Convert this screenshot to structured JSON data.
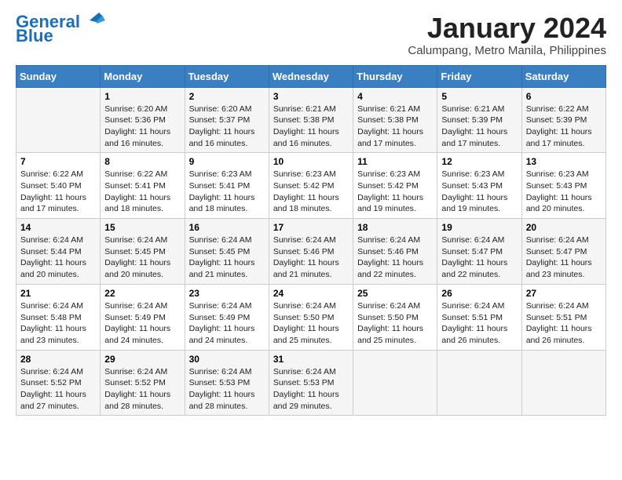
{
  "header": {
    "logo_general": "General",
    "logo_blue": "Blue",
    "month_title": "January 2024",
    "subtitle": "Calumpang, Metro Manila, Philippines"
  },
  "days_of_week": [
    "Sunday",
    "Monday",
    "Tuesday",
    "Wednesday",
    "Thursday",
    "Friday",
    "Saturday"
  ],
  "weeks": [
    [
      {
        "day": "",
        "sunrise": "",
        "sunset": "",
        "daylight": ""
      },
      {
        "day": "1",
        "sunrise": "Sunrise: 6:20 AM",
        "sunset": "Sunset: 5:36 PM",
        "daylight": "Daylight: 11 hours and 16 minutes."
      },
      {
        "day": "2",
        "sunrise": "Sunrise: 6:20 AM",
        "sunset": "Sunset: 5:37 PM",
        "daylight": "Daylight: 11 hours and 16 minutes."
      },
      {
        "day": "3",
        "sunrise": "Sunrise: 6:21 AM",
        "sunset": "Sunset: 5:38 PM",
        "daylight": "Daylight: 11 hours and 16 minutes."
      },
      {
        "day": "4",
        "sunrise": "Sunrise: 6:21 AM",
        "sunset": "Sunset: 5:38 PM",
        "daylight": "Daylight: 11 hours and 17 minutes."
      },
      {
        "day": "5",
        "sunrise": "Sunrise: 6:21 AM",
        "sunset": "Sunset: 5:39 PM",
        "daylight": "Daylight: 11 hours and 17 minutes."
      },
      {
        "day": "6",
        "sunrise": "Sunrise: 6:22 AM",
        "sunset": "Sunset: 5:39 PM",
        "daylight": "Daylight: 11 hours and 17 minutes."
      }
    ],
    [
      {
        "day": "7",
        "sunrise": "Sunrise: 6:22 AM",
        "sunset": "Sunset: 5:40 PM",
        "daylight": "Daylight: 11 hours and 17 minutes."
      },
      {
        "day": "8",
        "sunrise": "Sunrise: 6:22 AM",
        "sunset": "Sunset: 5:41 PM",
        "daylight": "Daylight: 11 hours and 18 minutes."
      },
      {
        "day": "9",
        "sunrise": "Sunrise: 6:23 AM",
        "sunset": "Sunset: 5:41 PM",
        "daylight": "Daylight: 11 hours and 18 minutes."
      },
      {
        "day": "10",
        "sunrise": "Sunrise: 6:23 AM",
        "sunset": "Sunset: 5:42 PM",
        "daylight": "Daylight: 11 hours and 18 minutes."
      },
      {
        "day": "11",
        "sunrise": "Sunrise: 6:23 AM",
        "sunset": "Sunset: 5:42 PM",
        "daylight": "Daylight: 11 hours and 19 minutes."
      },
      {
        "day": "12",
        "sunrise": "Sunrise: 6:23 AM",
        "sunset": "Sunset: 5:43 PM",
        "daylight": "Daylight: 11 hours and 19 minutes."
      },
      {
        "day": "13",
        "sunrise": "Sunrise: 6:23 AM",
        "sunset": "Sunset: 5:43 PM",
        "daylight": "Daylight: 11 hours and 20 minutes."
      }
    ],
    [
      {
        "day": "14",
        "sunrise": "Sunrise: 6:24 AM",
        "sunset": "Sunset: 5:44 PM",
        "daylight": "Daylight: 11 hours and 20 minutes."
      },
      {
        "day": "15",
        "sunrise": "Sunrise: 6:24 AM",
        "sunset": "Sunset: 5:45 PM",
        "daylight": "Daylight: 11 hours and 20 minutes."
      },
      {
        "day": "16",
        "sunrise": "Sunrise: 6:24 AM",
        "sunset": "Sunset: 5:45 PM",
        "daylight": "Daylight: 11 hours and 21 minutes."
      },
      {
        "day": "17",
        "sunrise": "Sunrise: 6:24 AM",
        "sunset": "Sunset: 5:46 PM",
        "daylight": "Daylight: 11 hours and 21 minutes."
      },
      {
        "day": "18",
        "sunrise": "Sunrise: 6:24 AM",
        "sunset": "Sunset: 5:46 PM",
        "daylight": "Daylight: 11 hours and 22 minutes."
      },
      {
        "day": "19",
        "sunrise": "Sunrise: 6:24 AM",
        "sunset": "Sunset: 5:47 PM",
        "daylight": "Daylight: 11 hours and 22 minutes."
      },
      {
        "day": "20",
        "sunrise": "Sunrise: 6:24 AM",
        "sunset": "Sunset: 5:47 PM",
        "daylight": "Daylight: 11 hours and 23 minutes."
      }
    ],
    [
      {
        "day": "21",
        "sunrise": "Sunrise: 6:24 AM",
        "sunset": "Sunset: 5:48 PM",
        "daylight": "Daylight: 11 hours and 23 minutes."
      },
      {
        "day": "22",
        "sunrise": "Sunrise: 6:24 AM",
        "sunset": "Sunset: 5:49 PM",
        "daylight": "Daylight: 11 hours and 24 minutes."
      },
      {
        "day": "23",
        "sunrise": "Sunrise: 6:24 AM",
        "sunset": "Sunset: 5:49 PM",
        "daylight": "Daylight: 11 hours and 24 minutes."
      },
      {
        "day": "24",
        "sunrise": "Sunrise: 6:24 AM",
        "sunset": "Sunset: 5:50 PM",
        "daylight": "Daylight: 11 hours and 25 minutes."
      },
      {
        "day": "25",
        "sunrise": "Sunrise: 6:24 AM",
        "sunset": "Sunset: 5:50 PM",
        "daylight": "Daylight: 11 hours and 25 minutes."
      },
      {
        "day": "26",
        "sunrise": "Sunrise: 6:24 AM",
        "sunset": "Sunset: 5:51 PM",
        "daylight": "Daylight: 11 hours and 26 minutes."
      },
      {
        "day": "27",
        "sunrise": "Sunrise: 6:24 AM",
        "sunset": "Sunset: 5:51 PM",
        "daylight": "Daylight: 11 hours and 26 minutes."
      }
    ],
    [
      {
        "day": "28",
        "sunrise": "Sunrise: 6:24 AM",
        "sunset": "Sunset: 5:52 PM",
        "daylight": "Daylight: 11 hours and 27 minutes."
      },
      {
        "day": "29",
        "sunrise": "Sunrise: 6:24 AM",
        "sunset": "Sunset: 5:52 PM",
        "daylight": "Daylight: 11 hours and 28 minutes."
      },
      {
        "day": "30",
        "sunrise": "Sunrise: 6:24 AM",
        "sunset": "Sunset: 5:53 PM",
        "daylight": "Daylight: 11 hours and 28 minutes."
      },
      {
        "day": "31",
        "sunrise": "Sunrise: 6:24 AM",
        "sunset": "Sunset: 5:53 PM",
        "daylight": "Daylight: 11 hours and 29 minutes."
      },
      {
        "day": "",
        "sunrise": "",
        "sunset": "",
        "daylight": ""
      },
      {
        "day": "",
        "sunrise": "",
        "sunset": "",
        "daylight": ""
      },
      {
        "day": "",
        "sunrise": "",
        "sunset": "",
        "daylight": ""
      }
    ]
  ]
}
